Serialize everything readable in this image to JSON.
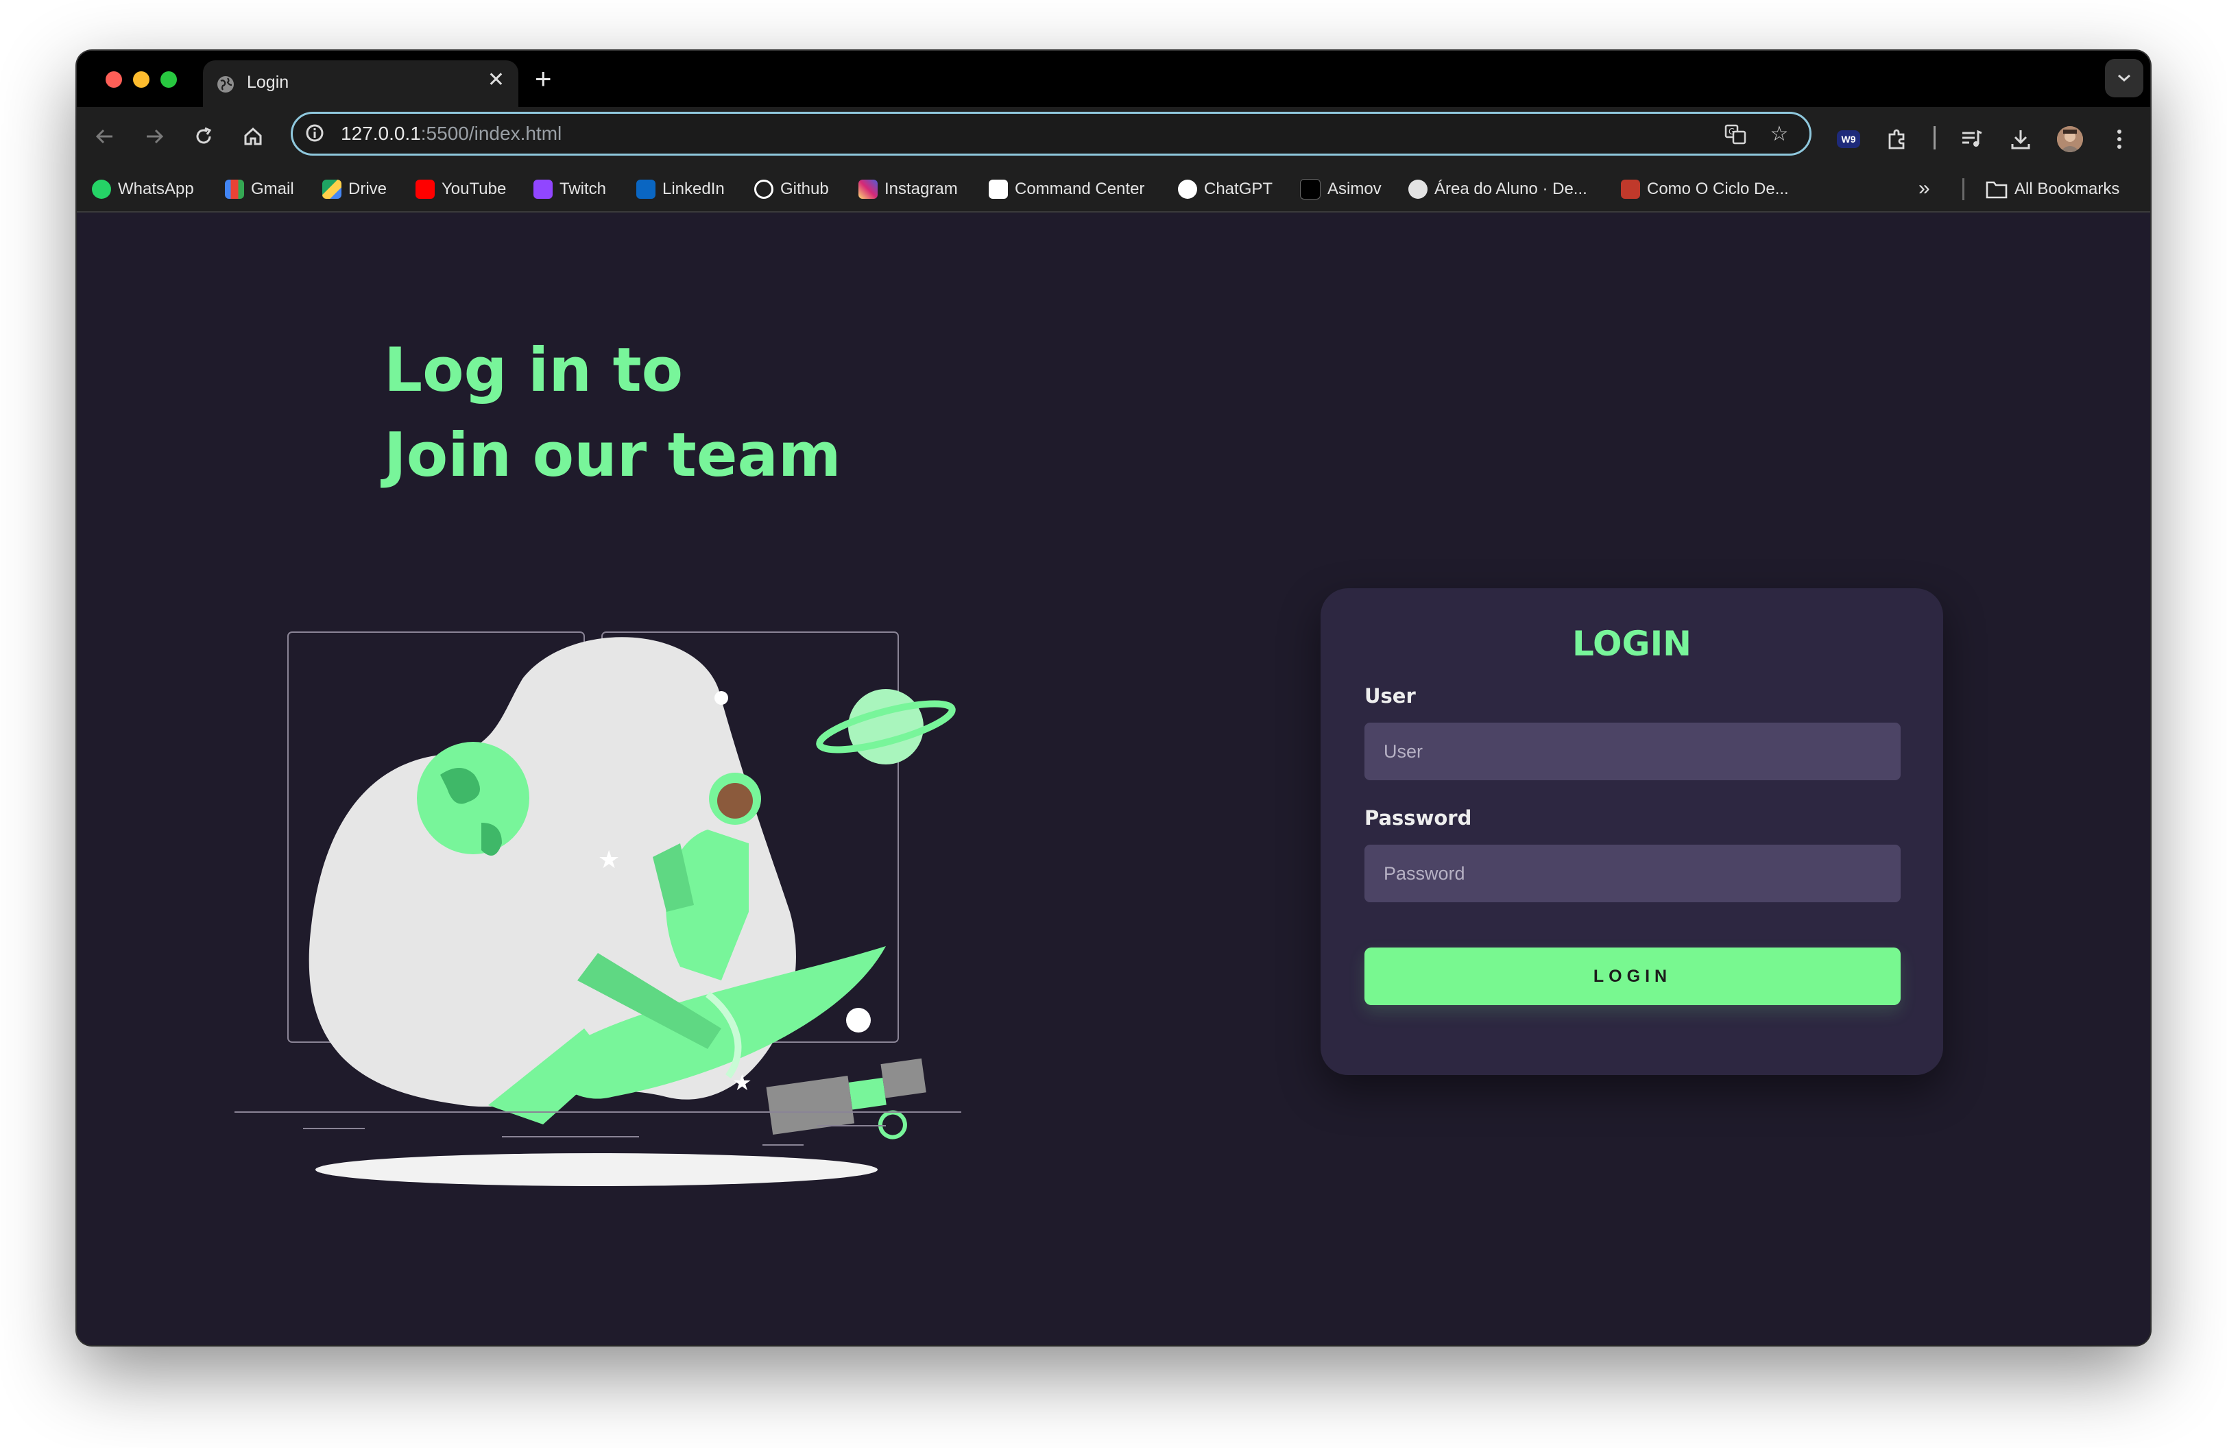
{
  "browser": {
    "tab": {
      "title": "Login"
    },
    "new_tab_symbol": "+",
    "address_bar": {
      "host": "127.0.0.1",
      "path": ":5500/index.html"
    },
    "bookmarks": [
      {
        "label": "WhatsApp",
        "color": "#25d366"
      },
      {
        "label": "Gmail",
        "color": "#ea4335"
      },
      {
        "label": "Drive",
        "color": "#1fa463"
      },
      {
        "label": "YouTube",
        "color": "#ff0000"
      },
      {
        "label": "Twitch",
        "color": "#9146ff"
      },
      {
        "label": "LinkedIn",
        "color": "#0a66c2"
      },
      {
        "label": "Github",
        "color": "#ffffff"
      },
      {
        "label": "Instagram",
        "color": "#e1306c"
      },
      {
        "label": "Command Center",
        "color": "#ffffff"
      },
      {
        "label": "ChatGPT",
        "color": "#ffffff"
      },
      {
        "label": "Asimov",
        "color": "#000000"
      },
      {
        "label": "Área do Aluno · De...",
        "color": "#ffffff"
      },
      {
        "label": "Como O Ciclo De...",
        "color": "#c0392b"
      }
    ],
    "all_bookmarks_label": "All Bookmarks",
    "extension_badge": "W9"
  },
  "page": {
    "hero_line1": "Log in to",
    "hero_line2": "Join our team",
    "login_form": {
      "heading": "LOGIN",
      "user_label": "User",
      "user_placeholder": "User",
      "password_label": "Password",
      "password_placeholder": "Password",
      "submit_label": "LOGIN"
    }
  },
  "colors": {
    "page_background": "#1f1b2b",
    "card_background": "#2d2741",
    "accent_green": "#78f59a",
    "input_background": "#4c4465"
  }
}
